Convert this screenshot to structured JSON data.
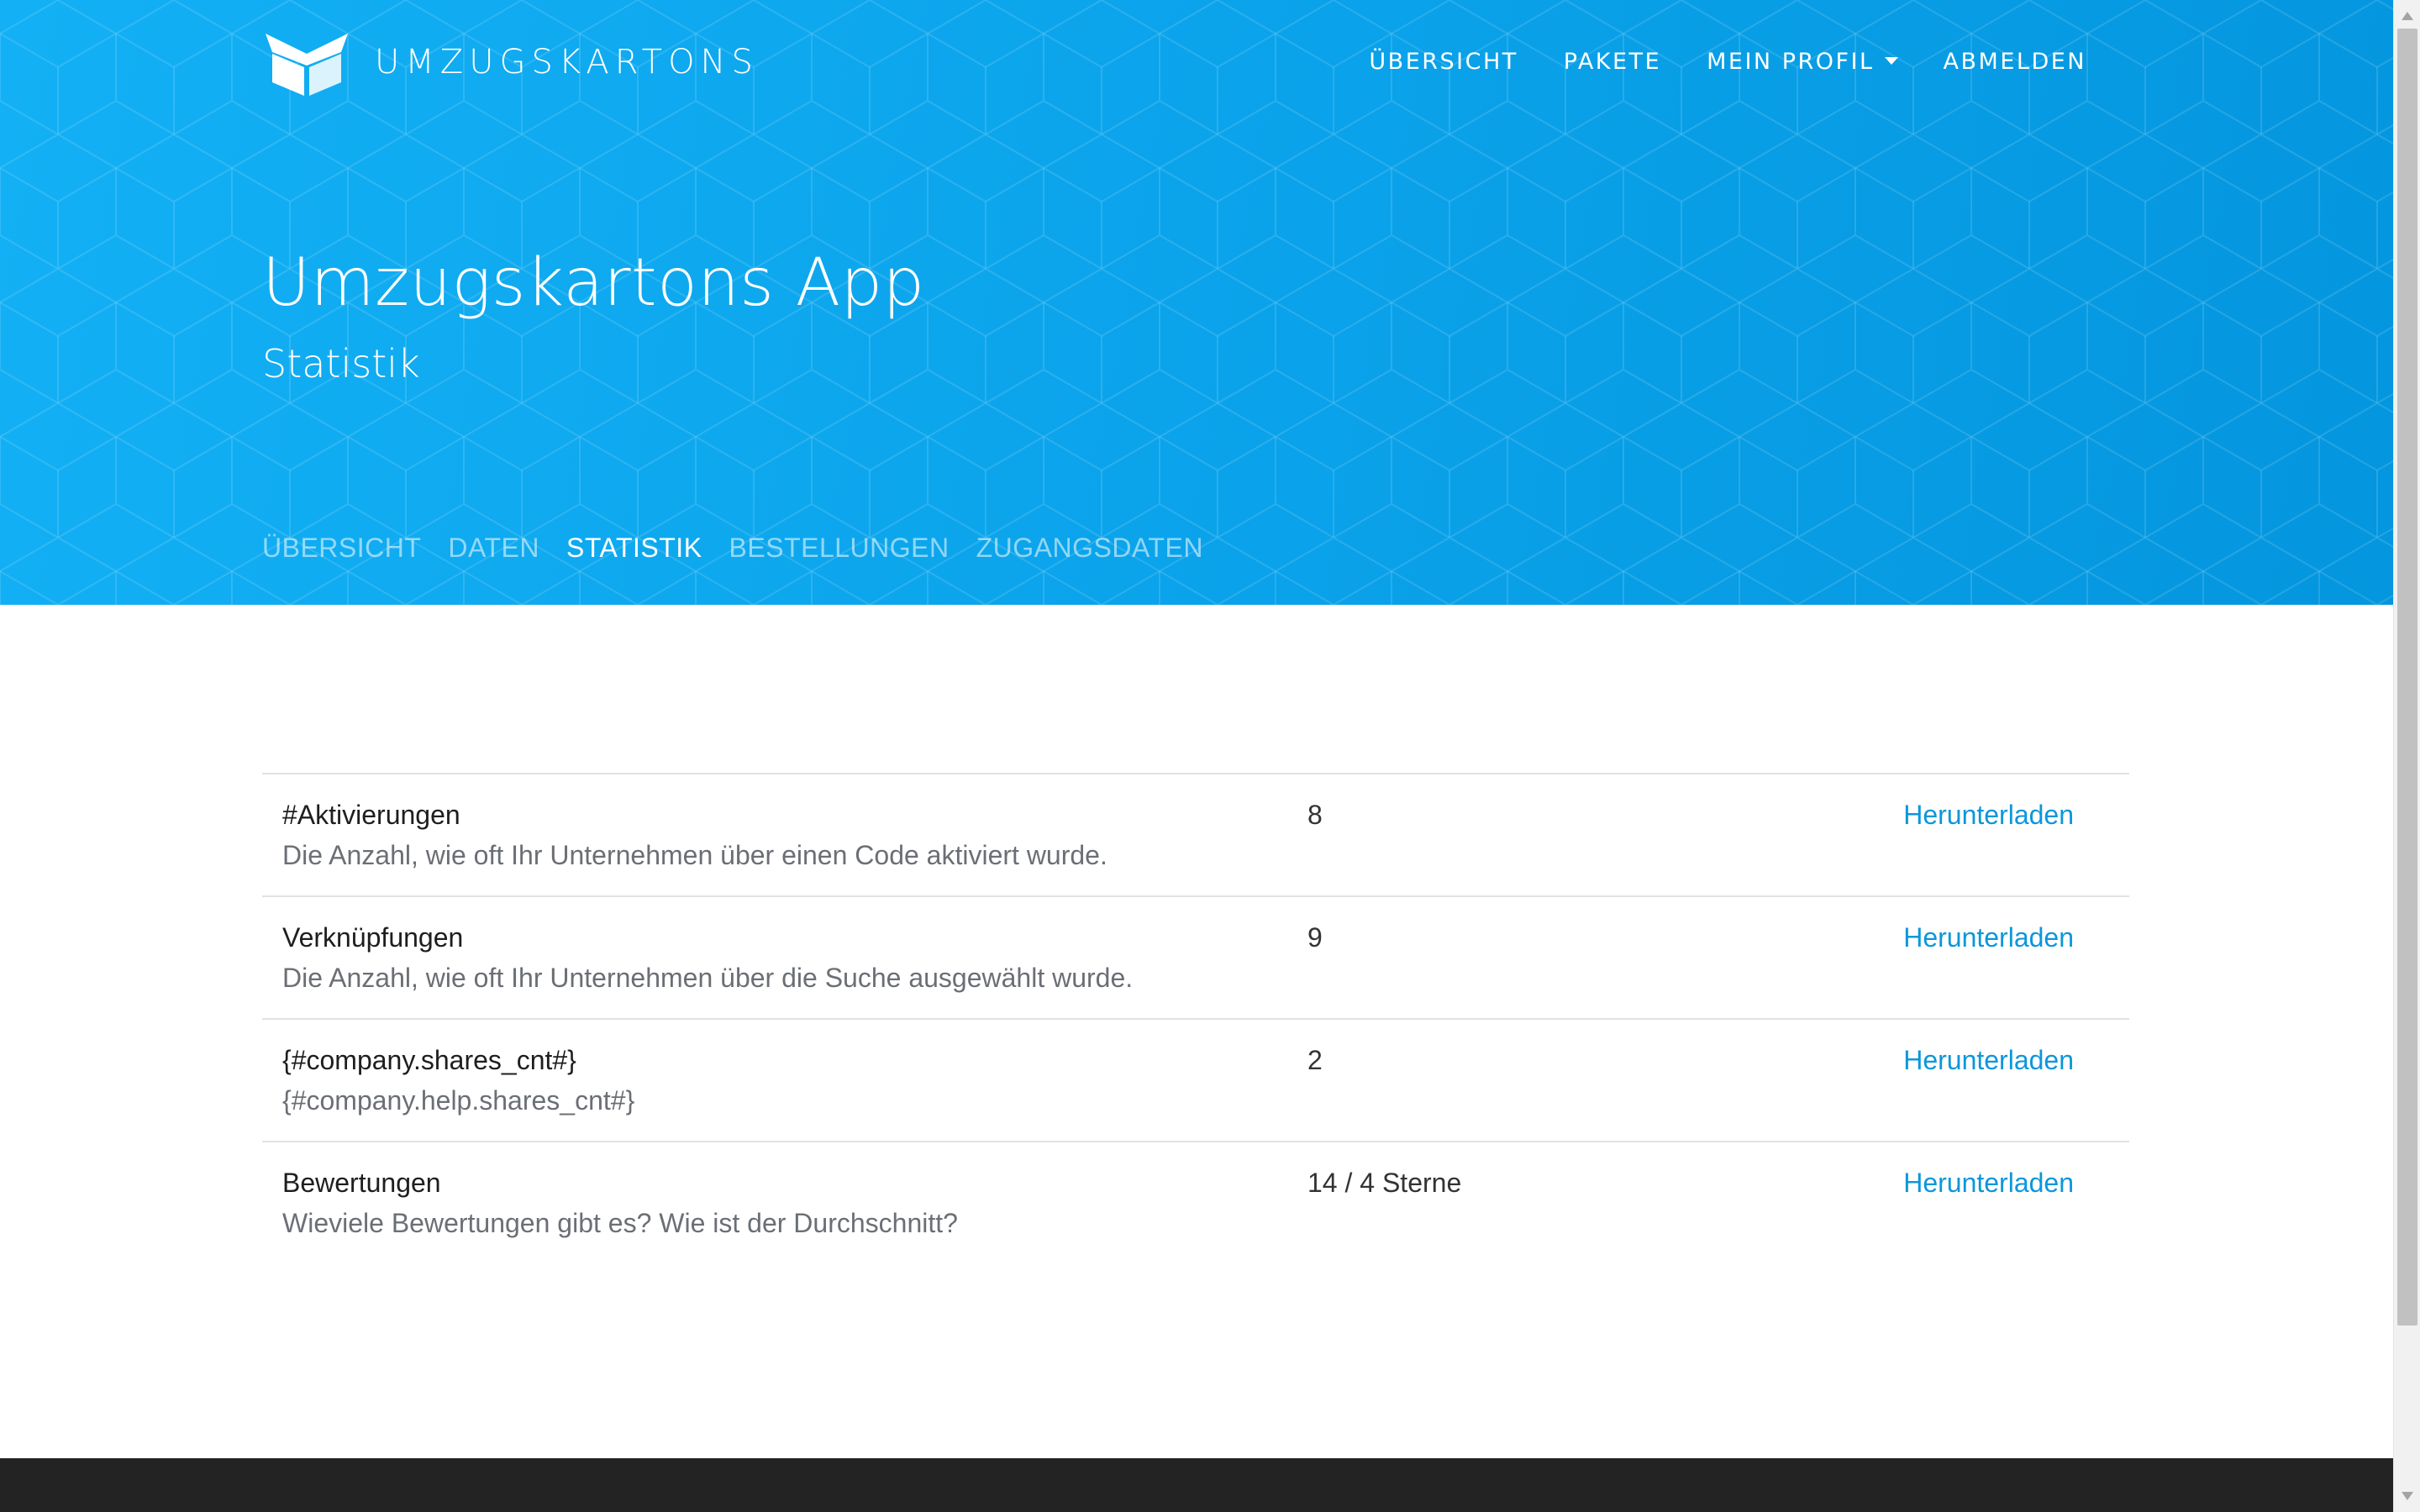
{
  "brand": {
    "name": "UMZUGSKARTONS",
    "logo_icon": "box-logo-icon"
  },
  "topnav": {
    "items": [
      {
        "label": "ÜBERSICHT"
      },
      {
        "label": "PAKETE"
      },
      {
        "label": "MEIN PROFIL",
        "has_dropdown": true
      },
      {
        "label": "ABMELDEN"
      }
    ]
  },
  "hero": {
    "title": "Umzugskartons App",
    "subtitle": "Statistik"
  },
  "subnav": {
    "items": [
      {
        "label": "ÜBERSICHT",
        "active": false
      },
      {
        "label": "DATEN",
        "active": false
      },
      {
        "label": "STATISTIK",
        "active": true
      },
      {
        "label": "BESTELLUNGEN",
        "active": false
      },
      {
        "label": "ZUGANGSDATEN",
        "active": false
      }
    ]
  },
  "stats": {
    "rows": [
      {
        "label": "#Aktivierungen",
        "description": "Die Anzahl, wie oft Ihr Unternehmen über einen Code aktiviert wurde.",
        "value": "8",
        "action": "Herunterladen"
      },
      {
        "label": "Verknüpfungen",
        "description": "Die Anzahl, wie oft Ihr Unternehmen über die Suche ausgewählt wurde.",
        "value": "9",
        "action": "Herunterladen"
      },
      {
        "label": "{#company.shares_cnt#}",
        "description": "{#company.help.shares_cnt#}",
        "value": "2",
        "action": "Herunterladen"
      },
      {
        "label": "Bewertungen",
        "description": "Wieviele Bewertungen gibt es? Wie ist der Durchschnitt?",
        "value": "14 / 4 Sterne",
        "action": "Herunterladen"
      }
    ]
  },
  "colors": {
    "hero_start": "#13b0f5",
    "hero_end": "#0496de",
    "link": "#0b97db",
    "footer": "#232323"
  }
}
